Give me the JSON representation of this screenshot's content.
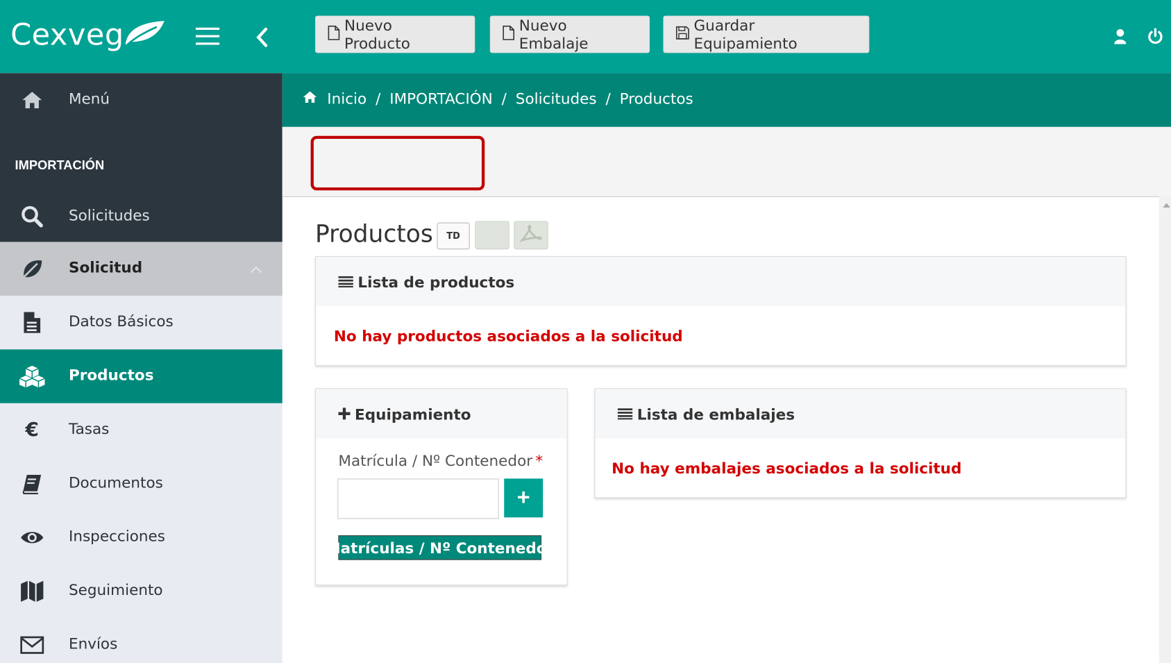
{
  "app": {
    "name": "Cexveg"
  },
  "colors": {
    "brand": "#00a294",
    "brand_dark": "#008577",
    "sidebar_dark": "#2c363f",
    "error": "#d40000",
    "highlight": "#c00000"
  },
  "sidebar": {
    "menu_label": "Menú",
    "section_title": "IMPORTACIÓN",
    "items": [
      {
        "label": "Solicitudes",
        "icon": "search-icon"
      },
      {
        "label": "Solicitud",
        "icon": "leaf-icon"
      },
      {
        "label": "Datos Básicos",
        "icon": "file-icon"
      },
      {
        "label": "Productos",
        "icon": "cubes-icon"
      },
      {
        "label": "Tasas",
        "icon": "euro-icon"
      },
      {
        "label": "Documentos",
        "icon": "book-icon"
      },
      {
        "label": "Inspecciones",
        "icon": "eye-icon"
      },
      {
        "label": "Seguimiento",
        "icon": "map-icon"
      },
      {
        "label": "Envíos",
        "icon": "envelope-icon"
      }
    ]
  },
  "breadcrumb": [
    "Inicio",
    "IMPORTACIÓN",
    "Solicitudes",
    "Productos"
  ],
  "toolbar": {
    "nuevo_producto": "Nuevo Producto",
    "nuevo_embalaje": "Nuevo Embalaje",
    "guardar_equipamiento": "Guardar Equipamiento"
  },
  "page": {
    "title": "Productos",
    "td_badge": "TD"
  },
  "productos_panel": {
    "title": "Lista de productos",
    "empty": "No hay productos asociados a la solicitud"
  },
  "equipamiento_panel": {
    "title": "Equipamiento",
    "field_label": "Matrícula / Nº Contenedor",
    "required_mark": "*",
    "input_value": "",
    "add_label": "+",
    "table_header": "Matrículas / Nº Contenedor"
  },
  "embalajes_panel": {
    "title": "Lista de embalajes",
    "empty": "No hay embalajes asociados a la solicitud"
  }
}
